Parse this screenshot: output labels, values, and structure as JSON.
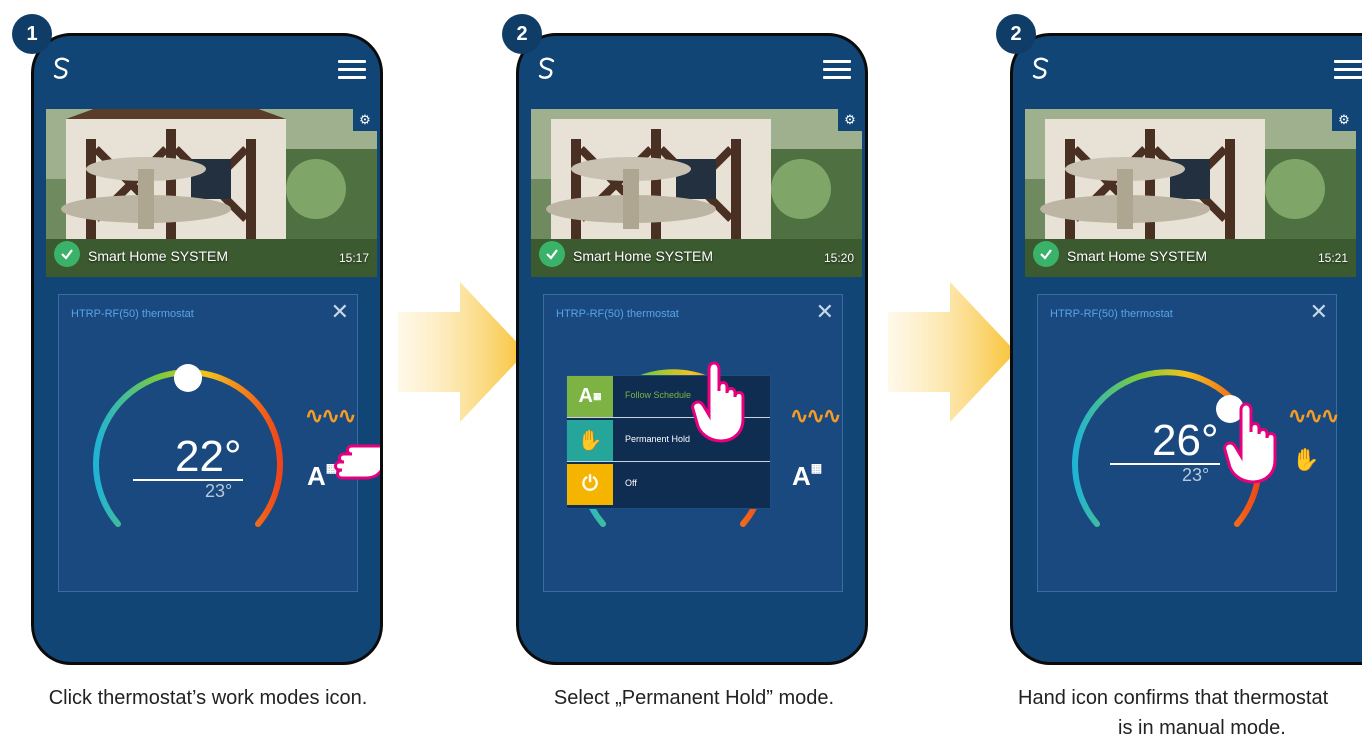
{
  "steps": [
    {
      "badge": "1",
      "system": "Smart Home SYSTEM",
      "time": "15:17",
      "panel_title": "HTRP-RF(50) thermostat",
      "set_temp": "22°",
      "current_temp": "23°",
      "caption_line1": "Click thermostat’s work modes icon.",
      "caption_line2": ""
    },
    {
      "badge": "2",
      "system": "Smart Home SYSTEM",
      "time": "15:20",
      "panel_title": "HTRP-RF(50) thermostat",
      "set_temp": "",
      "current_temp": "",
      "caption_line1": "Select „Permanent Hold” mode.",
      "caption_line2": ""
    },
    {
      "badge": "2",
      "system": "Smart Home SYSTEM",
      "time": "15:21",
      "panel_title": "HTRP-RF(50) thermostat",
      "set_temp": "26°",
      "current_temp": "23°",
      "caption_line1": "Hand icon confirms that thermostat",
      "caption_line2": "is in manual mode."
    }
  ],
  "mode_menu": [
    {
      "label": "Follow Schedule",
      "color": "#7cb342",
      "label_color": "#7cb342",
      "icon": "auto-schedule-icon"
    },
    {
      "label": "Permanent Hold",
      "color": "#26a69a",
      "label_color": "#ffffff",
      "icon": "hand-icon"
    },
    {
      "label": "Off",
      "color": "#f5b400",
      "label_color": "#ffffff",
      "icon": "power-icon"
    }
  ],
  "colors": {
    "phone_bg": "#114575",
    "panel_title": "#58a4ea",
    "heat": "#f39c26",
    "arrow": "#f8c233"
  }
}
